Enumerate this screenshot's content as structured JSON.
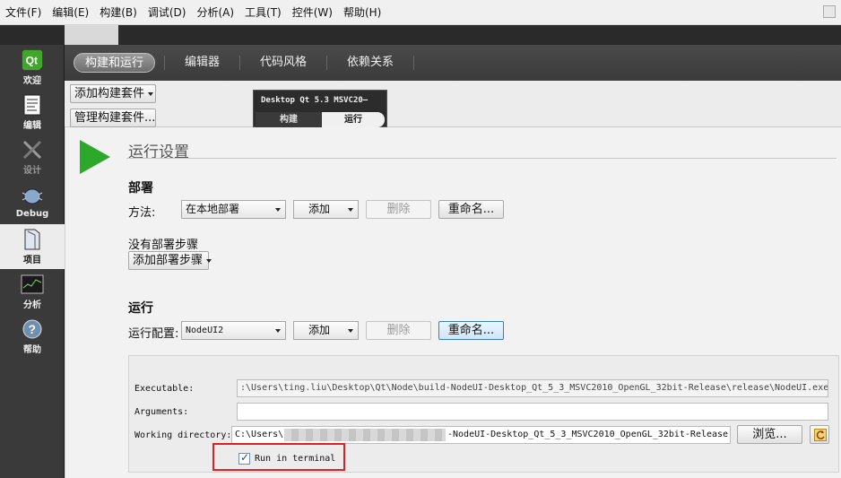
{
  "menu": [
    "文件(F)",
    "编辑(E)",
    "构建(B)",
    "调试(D)",
    "分析(A)",
    "工具(T)",
    "控件(W)",
    "帮助(H)"
  ],
  "modes": {
    "welcome": "欢迎",
    "edit": "编辑",
    "design": "设计",
    "debug": "Debug",
    "projects": "项目",
    "analyze": "分析",
    "help": "帮助"
  },
  "project_tabs": [
    "构建和运行",
    "编辑器",
    "代码风格",
    "依赖关系"
  ],
  "toolbar": {
    "add_kit": "添加构建套件",
    "manage_kits": "管理构建套件...",
    "kit_name": "Desktop Qt 5.3 MSVC20—",
    "kit_build": "构建",
    "kit_run": "运行"
  },
  "run_settings": {
    "title": "运行设置",
    "deploy": {
      "heading": "部署",
      "method_label": "方法:",
      "method_value": "在本地部署",
      "add": "添加",
      "remove": "删除",
      "rename": "重命名...",
      "no_steps": "没有部署步骤",
      "add_step": "添加部署步骤"
    },
    "run": {
      "heading": "运行",
      "config_label": "运行配置:",
      "config_value": "NodeUI2",
      "add": "添加",
      "remove": "删除",
      "rename": "重命名..."
    },
    "executable_label": "Executable:",
    "executable_value": ":\\Users\\ting.liu\\Desktop\\Qt\\Node\\build-NodeUI-Desktop_Qt_5_3_MSVC2010_OpenGL_32bit-Release\\release\\NodeUI.exe",
    "arguments_label": "Arguments:",
    "arguments_value": "",
    "workdir_label": "Working directory:",
    "workdir_prefix": "C:\\Users\\",
    "workdir_suffix": "-NodeUI-Desktop_Qt_5_3_MSVC2010_OpenGL_32bit-Release",
    "browse": "浏览...",
    "run_in_terminal": "Run in terminal",
    "run_in_terminal_checked": true
  },
  "colors": {
    "accent_green": "#2ca82a",
    "highlight_red": "#e02020"
  }
}
